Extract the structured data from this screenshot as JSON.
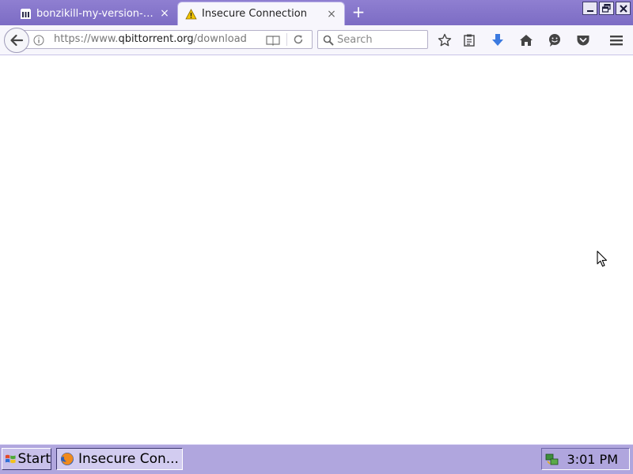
{
  "tabs": [
    {
      "title": "bonzikill-my-version-upd…",
      "icon": "archive-icon",
      "close": "×",
      "active": false
    },
    {
      "title": "Insecure Connection",
      "icon": "warning-icon",
      "close": "×",
      "active": true
    }
  ],
  "new_tab": "+",
  "navbar": {
    "url_prefix": "https://www.",
    "url_host": "qbittorrent.org",
    "url_path": "/download",
    "search_placeholder": "Search"
  },
  "taskbar": {
    "start_label": "Start",
    "task_label": "Insecure Con...",
    "clock": "3:01 PM"
  },
  "colors": {
    "tabbar": "#8f7fd1",
    "taskbar": "#b0a6de",
    "download_arrow": "#3c7ae0"
  }
}
